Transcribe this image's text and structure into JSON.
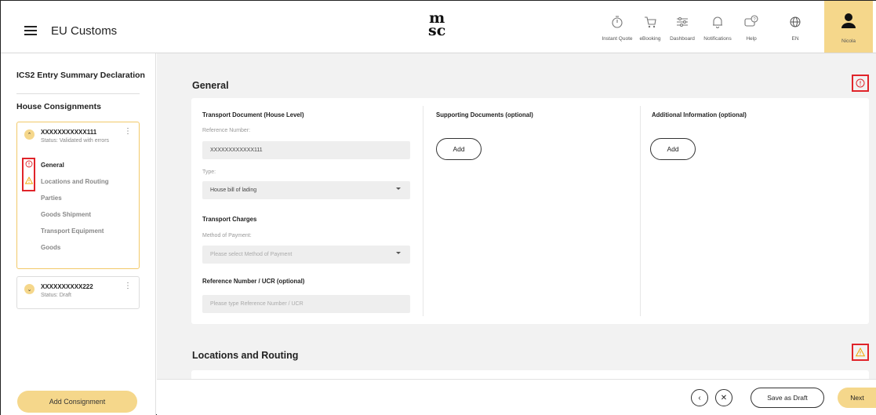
{
  "header": {
    "app_title": "EU Customs",
    "logo_text_top": "m",
    "logo_text_bottom": "sc",
    "nav": [
      {
        "label": "Instant Quote",
        "icon": "stopwatch-icon"
      },
      {
        "label": "eBooking",
        "icon": "cart-icon"
      },
      {
        "label": "Dashboard",
        "icon": "dashboard-icon"
      },
      {
        "label": "Notifications",
        "icon": "bell-icon"
      },
      {
        "label": "Help",
        "icon": "help-icon"
      },
      {
        "label": "EN",
        "icon": "globe-icon"
      }
    ],
    "user_label": "Nicola"
  },
  "sidebar": {
    "title": "ICS2 Entry Summary Declaration",
    "section_title": "House Consignments",
    "consignments": [
      {
        "name": "XXXXXXXXXXX111",
        "status": "Status: Validated with errors",
        "expanded": true,
        "menu": [
          {
            "label": "General",
            "state": "error"
          },
          {
            "label": "Locations and Routing",
            "state": "warning"
          },
          {
            "label": "Parties",
            "state": ""
          },
          {
            "label": "Goods Shipment",
            "state": ""
          },
          {
            "label": "Transport Equipment",
            "state": ""
          },
          {
            "label": "Goods",
            "state": ""
          }
        ]
      },
      {
        "name": "XXXXXXXXXX222",
        "status": "Status: Draft",
        "expanded": false
      }
    ],
    "add_button": "Add Consignment"
  },
  "main": {
    "general": {
      "title": "General",
      "transport_document": {
        "title": "Transport Document (House Level)",
        "reference_label": "Reference Number:",
        "reference_value": "XXXXXXXXXXXX111",
        "type_label": "Type:",
        "type_value": "House bill of lading"
      },
      "transport_charges": {
        "title": "Transport Charges",
        "method_label": "Method of Payment:",
        "method_placeholder": "Please select Method of Payment"
      },
      "ucr": {
        "title": "Reference Number / UCR (optional)",
        "placeholder": "Please type Reference Number / UCR"
      },
      "supporting_documents": {
        "title": "Supporting Documents (optional)",
        "add_label": "Add"
      },
      "additional_information": {
        "title": "Additional Information (optional)",
        "add_label": "Add"
      }
    },
    "locations": {
      "title": "Locations and Routing"
    }
  },
  "footer": {
    "back_symbol": "‹",
    "close_symbol": "✕",
    "save_draft": "Save as Draft",
    "next": "Next"
  },
  "colors": {
    "accent": "#f5d78b",
    "error": "#e0242a",
    "warning": "#f0a500"
  }
}
